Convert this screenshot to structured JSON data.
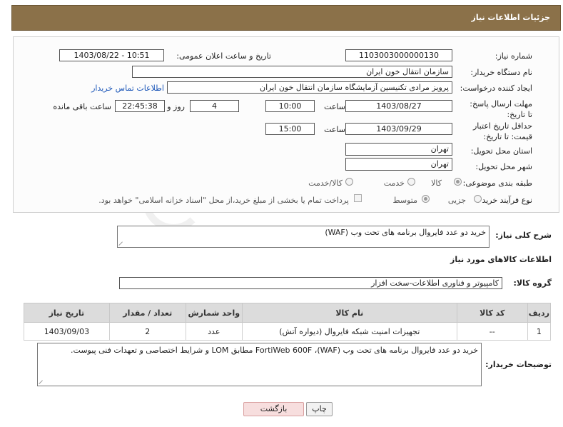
{
  "header": {
    "title": "جزئیات اطلاعات نیاز"
  },
  "form": {
    "need_number_label": "شماره نیاز:",
    "need_number": "1103003000000130",
    "announce_label": "تاریخ و ساعت اعلان عمومی:",
    "announce_value": "1403/08/22 - 10:51",
    "buyer_org_label": "نام دستگاه خریدار:",
    "buyer_org": "سازمان انتقال خون ایران",
    "requester_label": "ایجاد کننده درخواست:",
    "requester": "پرویز مرادی تکنیسین آزمایشگاه سازمان انتقال خون ایران",
    "contact_link": "اطلاعات تماس خریدار",
    "deadline_label": "مهلت ارسال پاسخ: تا تاریخ:",
    "deadline_date": "1403/08/27",
    "time_label": "ساعت",
    "deadline_time": "10:00",
    "days_value": "4",
    "day_and_label": "روز و",
    "remaining_time": "22:45:38",
    "remaining_label": "ساعت باقی مانده",
    "price_validity_label": "حداقل تاریخ اعتبار قیمت: تا تاریخ:",
    "price_validity_date": "1403/09/29",
    "price_validity_time": "15:00",
    "province_label": "استان محل تحویل:",
    "province": "تهران",
    "city_label": "شهر محل تحویل:",
    "city": "تهران",
    "category_label": "طبقه بندی موضوعی:",
    "category_options": [
      "کالا",
      "خدمت",
      "کالا/خدمت"
    ],
    "process_label": "نوع فرآیند خرید :",
    "process_options": [
      "جزیی",
      "متوسط"
    ],
    "payment_note": "پرداخت تمام یا بخشی از مبلغ خرید،از محل \"اسناد خزانه اسلامی\" خواهد بود."
  },
  "summary": {
    "label": "شرح کلی نیاز:",
    "text": "خرید دو عدد فایروال برنامه های تحت وب (WAF)"
  },
  "goods": {
    "section_title": "اطلاعات کالاهای مورد نیاز",
    "group_label": "گروه کالا:",
    "group_value": "کامپیوتر و فناوری اطلاعات-سخت افزار",
    "columns": [
      "ردیف",
      "کد کالا",
      "نام کالا",
      "واحد شمارش",
      "تعداد / مقدار",
      "تاریخ نیاز"
    ],
    "rows": [
      {
        "row": "1",
        "code": "--",
        "name": "تجهیزات امنیت شبکه فایروال (دیواره آتش)",
        "unit": "عدد",
        "qty": "2",
        "date": "1403/09/03"
      }
    ]
  },
  "buyer_notes": {
    "label": "توضیحات خریدار:",
    "text": "خرید دو عدد فایروال برنامه های تحت وب (WAF)، FortiWeb 600F مطابق LOM و شرایط اختصاصی و تعهدات فنی پیوست."
  },
  "buttons": {
    "print": "چاپ",
    "back": "بازگشت"
  },
  "watermark": "AriaTender.neT",
  "colors": {
    "header_bg": "#8b7149",
    "link": "#1a55b8",
    "back_button_bg": "#f7dede"
  }
}
